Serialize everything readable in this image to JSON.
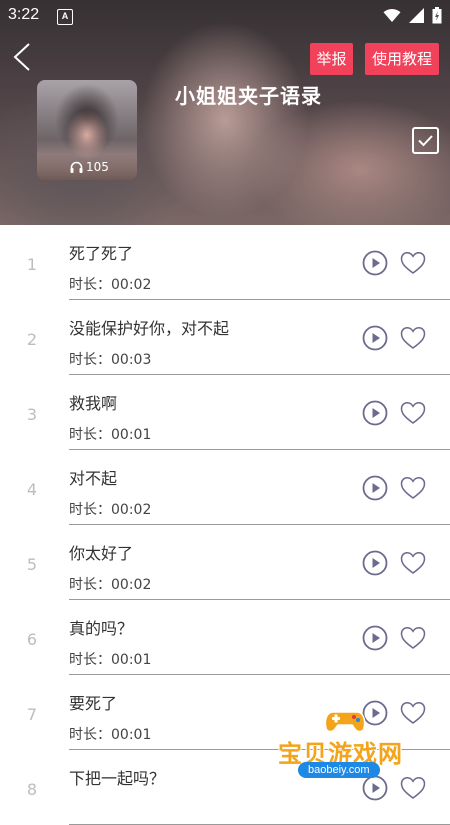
{
  "status_bar": {
    "time": "3:22",
    "a_icon": "A"
  },
  "header": {
    "title": "小姐姐夹子语录",
    "report_label": "举报",
    "tutorial_label": "使用教程",
    "play_count": "105"
  },
  "colors": {
    "accent": "#f2415a",
    "icon": "#6c6a8e",
    "watermark": "#f4a41a"
  },
  "tracks": [
    {
      "index": "1",
      "title": "死了死了",
      "duration": "时长：00:02"
    },
    {
      "index": "2",
      "title": "没能保护好你，对不起",
      "duration": "时长：00:03"
    },
    {
      "index": "3",
      "title": "救我啊",
      "duration": "时长：00:01"
    },
    {
      "index": "4",
      "title": "对不起",
      "duration": "时长：00:02"
    },
    {
      "index": "5",
      "title": "你太好了",
      "duration": "时长：00:02"
    },
    {
      "index": "6",
      "title": "真的吗？",
      "duration": "时长：00:01"
    },
    {
      "index": "7",
      "title": "要死了",
      "duration": "时长：00:01"
    },
    {
      "index": "8",
      "title": "下把一起吗？",
      "duration": ""
    }
  ],
  "watermark": {
    "text": "宝贝游戏网",
    "url": "baobeiy.com"
  }
}
